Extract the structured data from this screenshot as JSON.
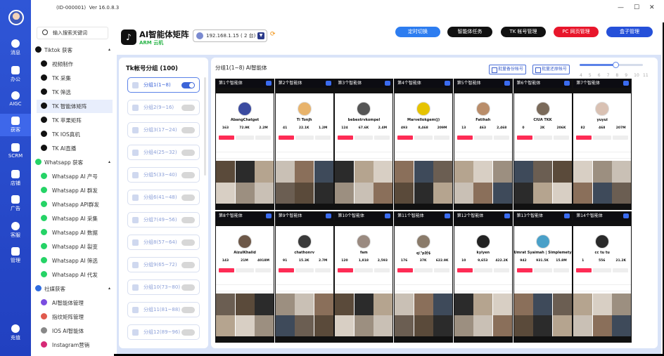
{
  "app": {
    "id_text": "(ID-000001)",
    "version": "Ver 16.0.8.3",
    "window_controls": [
      "—",
      "☐",
      "✕"
    ],
    "rail": [
      {
        "label": "消息"
      },
      {
        "label": "办公"
      },
      {
        "label": "AIGC"
      },
      {
        "label": "获客"
      },
      {
        "label": "SCRM"
      },
      {
        "label": "店铺"
      },
      {
        "label": "广告"
      },
      {
        "label": "客服"
      },
      {
        "label": "管理"
      },
      {
        "label": "充值"
      }
    ]
  },
  "nav": {
    "search_placeholder": "输入搜索关键词",
    "sections": [
      {
        "title": "Tiktok 获客",
        "items": [
          "视频制作",
          "TK 采集",
          "TK 筛选",
          "TK 智能体矩阵",
          "TK 苹果矩阵",
          "TK IOS真机",
          "TK AI直播"
        ]
      },
      {
        "title": "Whatsapp 获客",
        "items": [
          "Whatsapp AI 产号",
          "Whatsapp AI 群发",
          "Whatsapp API群发",
          "Whatsapp AI 采集",
          "Whatsapp AI 数据",
          "Whatsapp AI 裂变",
          "Whatsapp AI 筛选",
          "Whatsapp AI 代发"
        ]
      },
      {
        "title": "社媒获客",
        "items": [
          "AI智能体管理",
          "指纹矩阵管理",
          "IOS AI智能体",
          "Instagram营销"
        ]
      }
    ]
  },
  "header": {
    "logo_glyph": "♪",
    "title": "AI智能体矩阵",
    "subtitle": "ARM 云机",
    "ip_select": "192.168.1.15 ( 2 台)",
    "buttons": [
      {
        "label": "定时切换",
        "color": "#2d7df0"
      },
      {
        "label": "智能体任务",
        "color": "#111111"
      },
      {
        "label": "TK 帐号管理",
        "color": "#111111"
      },
      {
        "label": "PC 网页管理",
        "color": "#e8162b"
      },
      {
        "label": "盒子管理",
        "color": "#2550d9"
      }
    ]
  },
  "groups": {
    "title": "Tk帐号分组 (100)",
    "items": [
      "分组1(1~8)",
      "分组2(9~16)",
      "分组3(17~24)",
      "分组4(25~32)",
      "分组5(33~40)",
      "分组6(41~48)",
      "分组7(49~56)",
      "分组8(57~64)",
      "分组9(65~72)",
      "分组10(73~80)",
      "分组11(81~88)",
      "分组12(89~96)"
    ]
  },
  "grid": {
    "heading": "分组1(1~8) AI智能体",
    "backup_label": "批量备份帐号",
    "restore_label": "批量还原帐号",
    "zoom_ticks": [
      "4",
      "5",
      "6",
      "7",
      "8",
      "9",
      "10",
      "11"
    ],
    "zoom_value": 8,
    "devices": [
      {
        "label": "第1个智能体",
        "name": "AbangChatget",
        "stats": [
          "163",
          "72.9K",
          "2.2M"
        ],
        "color": "#3b4ba0"
      },
      {
        "label": "第2个智能体",
        "name": "Ti Tonjh",
        "stats": [
          "41",
          "22.1K",
          "1.2M"
        ],
        "color": "#e8b36b"
      },
      {
        "label": "第3个智能体",
        "name": "bebestrvkompel",
        "stats": [
          "124",
          "67.6K",
          "2.4M"
        ],
        "color": "#555555"
      },
      {
        "label": "第4个智能体",
        "name": "Marvellokgem(j)",
        "stats": [
          "493",
          "8,468",
          "209M"
        ],
        "color": "#e6c300"
      },
      {
        "label": "第5个智能体",
        "name": "Fatihah",
        "stats": [
          "13",
          "463",
          "2,468"
        ],
        "color": "#b98d6a"
      },
      {
        "label": "第6个智能体",
        "name": "CIUA TKK",
        "stats": [
          "0",
          "2K",
          "206K"
        ],
        "color": "#7a6a5a"
      },
      {
        "label": "第7个智能体",
        "name": "yuyui",
        "stats": [
          "82",
          "468",
          "207M"
        ],
        "color": "#d9c1b3"
      },
      {
        "label": "第8个智能体",
        "name": "AizulKhalid",
        "stats": [
          "143",
          "21M",
          "4018M"
        ],
        "color": "#6d5848"
      },
      {
        "label": "第9个智能体",
        "name": "chathonrv",
        "stats": [
          "91",
          "15.3K",
          "2.7M"
        ],
        "color": "#3a3a3a"
      },
      {
        "label": "第10个智能体",
        "name": "fam",
        "stats": [
          "120",
          "1,818",
          "2,593"
        ],
        "color": "#9a8a80"
      },
      {
        "label": "第11个智能体",
        "name": "q\\\"p对$",
        "stats": [
          "176",
          "37K",
          "622.9K"
        ],
        "color": "#8a7b6a"
      },
      {
        "label": "第12个智能体",
        "name": "kyiyen",
        "stats": [
          "10",
          "9,653",
          "422.2K"
        ],
        "color": "#222222"
      },
      {
        "label": "第13个智能体",
        "name": "Umrat Syaimah | Simplemetyse",
        "stats": [
          "942",
          "931.5K",
          "15.8M"
        ],
        "color": "#4aa0c8"
      },
      {
        "label": "第14个智能体",
        "name": "cc tu tu",
        "stats": [
          "1",
          "556",
          "21.2K"
        ],
        "color": "#2a2a2a"
      }
    ]
  },
  "colors": {
    "accent": "#2f56d6",
    "content_bg": "#d9e3f8",
    "tiktok_red": "#fe2c55"
  }
}
